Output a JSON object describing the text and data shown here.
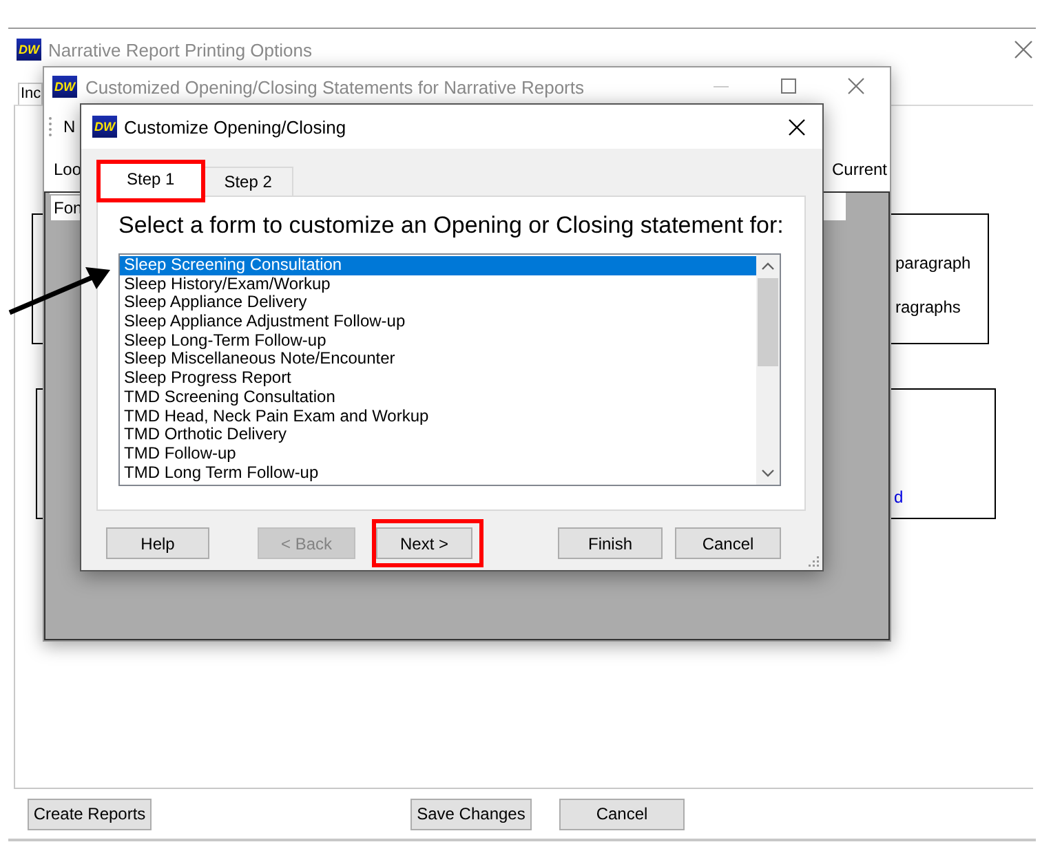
{
  "main_window": {
    "logo": "DW",
    "title": "Narrative Report Printing Options",
    "tab": "Inc",
    "right_texts": [
      "paragraph",
      "ragraphs"
    ],
    "link_fragment": "d",
    "buttons": [
      {
        "label": "Create Reports"
      },
      {
        "label": "Save Changes"
      },
      {
        "label": "Cancel"
      }
    ]
  },
  "statements_window": {
    "logo": "DW",
    "title": "Customized Opening/Closing Statements for Narrative Reports",
    "toolbar_text": "N",
    "label_left": "Loo",
    "label_right": "Current",
    "tab": "Fon"
  },
  "dialog": {
    "logo": "DW",
    "title": "Customize Opening/Closing",
    "tabs": [
      {
        "label": "Step 1",
        "selected": true,
        "highlighted": true
      },
      {
        "label": "Step 2",
        "selected": false,
        "highlighted": false
      }
    ],
    "prompt": "Select a form to customize an Opening or Closing statement for:",
    "forms": [
      {
        "label": "Sleep Screening Consultation",
        "selected": true
      },
      {
        "label": "Sleep History/Exam/Workup",
        "selected": false
      },
      {
        "label": "Sleep Appliance Delivery",
        "selected": false
      },
      {
        "label": "Sleep Appliance Adjustment Follow-up",
        "selected": false
      },
      {
        "label": "Sleep Long-Term Follow-up",
        "selected": false
      },
      {
        "label": "Sleep Miscellaneous Note/Encounter",
        "selected": false
      },
      {
        "label": "Sleep Progress Report",
        "selected": false
      },
      {
        "label": "TMD Screening Consultation",
        "selected": false
      },
      {
        "label": "TMD Head, Neck Pain Exam and Workup",
        "selected": false
      },
      {
        "label": "TMD Orthotic Delivery",
        "selected": false
      },
      {
        "label": "TMD Follow-up",
        "selected": false
      },
      {
        "label": "TMD Long Term Follow-up",
        "selected": false
      }
    ],
    "buttons": [
      {
        "label": "Help",
        "disabled": false,
        "highlighted": false
      },
      {
        "label": "< Back",
        "disabled": true,
        "highlighted": false
      },
      {
        "label": "Next >",
        "disabled": false,
        "highlighted": true
      },
      {
        "label": "Finish",
        "disabled": false,
        "highlighted": false
      },
      {
        "label": "Cancel",
        "disabled": false,
        "highlighted": false
      }
    ]
  }
}
